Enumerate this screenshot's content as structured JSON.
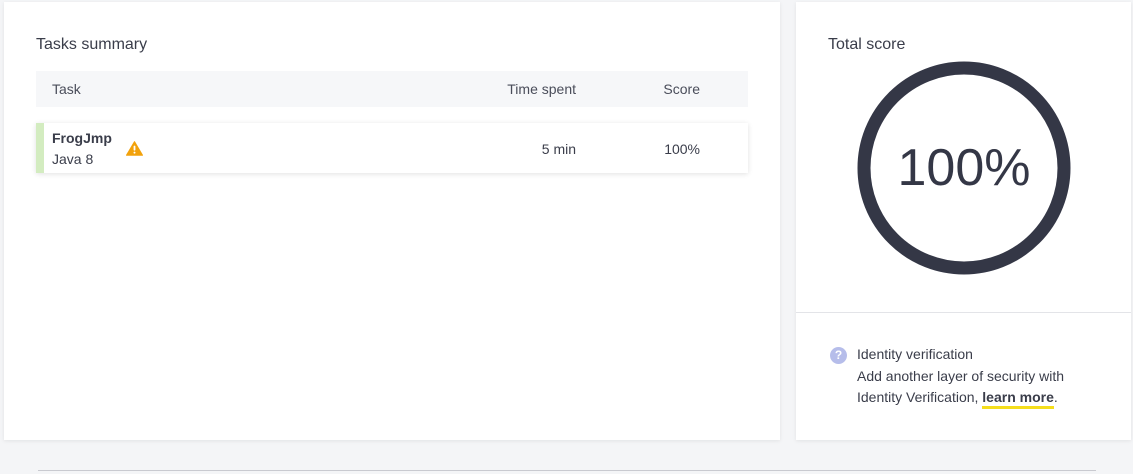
{
  "summary": {
    "title": "Tasks summary",
    "columns": {
      "task": "Task",
      "time_spent": "Time spent",
      "score": "Score"
    },
    "rows": [
      {
        "name": "FrogJmp",
        "language": "Java 8",
        "time_spent": "5 min",
        "score": "100%",
        "warning_icon": "warning-icon",
        "accent_color": "#d3ecc0"
      }
    ]
  },
  "total_score": {
    "title": "Total score",
    "value": "100%",
    "fraction": 1.0,
    "ring_color": "#343746"
  },
  "identity": {
    "icon": "help-icon",
    "title": "Identity verification",
    "line1": "Add another layer of security with",
    "line2_prefix": "Identity Verification, ",
    "link_label": "learn more",
    "line2_suffix": ".",
    "link_underline_color": "#f5de1c"
  },
  "colors": {
    "warning": "#f2a20c",
    "help_icon": "#b6bdea"
  }
}
